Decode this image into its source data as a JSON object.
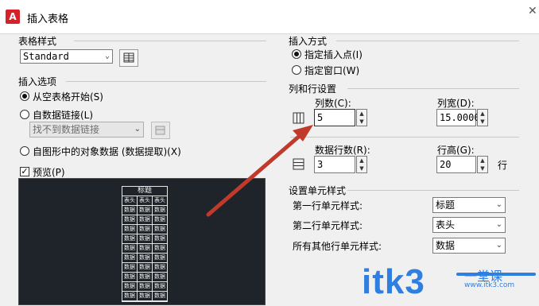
{
  "window": {
    "title": "插入表格",
    "app_icon": "A"
  },
  "table_style": {
    "label": "表格样式",
    "selected": "Standard"
  },
  "insert_options": {
    "label": "插入选项",
    "from_empty": "从空表格开始(S)",
    "from_data_link": "自数据链接(L)",
    "data_link_placeholder": "找不到数据链接",
    "from_object_data": "自图形中的对象数据 (数据提取)(X)"
  },
  "preview": {
    "label": "预览(P)",
    "checked": true,
    "table": {
      "title": "标题",
      "header": [
        "表头",
        "表头",
        "表头"
      ],
      "rows": [
        [
          "数据",
          "数据",
          "数据"
        ],
        [
          "数据",
          "数据",
          "数据"
        ],
        [
          "数据",
          "数据",
          "数据"
        ],
        [
          "数据",
          "数据",
          "数据"
        ],
        [
          "数据",
          "数据",
          "数据"
        ],
        [
          "数据",
          "数据",
          "数据"
        ],
        [
          "数据",
          "数据",
          "数据"
        ],
        [
          "数据",
          "数据",
          "数据"
        ],
        [
          "数据",
          "数据",
          "数据"
        ],
        [
          "数据",
          "数据",
          "数据"
        ]
      ]
    }
  },
  "insert_mode": {
    "label": "插入方式",
    "specify_point": "指定插入点(I)",
    "specify_window": "指定窗口(W)"
  },
  "column_row": {
    "label": "列和行设置",
    "columns_label": "列数(C):",
    "columns_value": "5",
    "col_width_label": "列宽(D):",
    "col_width_value": "15.0000",
    "data_rows_label": "数据行数(R):",
    "data_rows_value": "3",
    "row_height_label": "行高(G):",
    "row_height_value": "20",
    "row_unit": "行"
  },
  "cell_styles": {
    "label": "设置单元样式",
    "first_row_label": "第一行单元样式:",
    "first_row_value": "标题",
    "second_row_label": "第二行单元样式:",
    "second_row_value": "表头",
    "other_rows_label": "所有其他行单元样式:",
    "other_rows_value": "数据"
  },
  "watermark": {
    "text": "itk3",
    "cn": "一堂课",
    "sub": "www.itk3.com"
  },
  "colors": {
    "arrow": "#c0392b",
    "accent": "#2f7fe0",
    "preview_bg": "#1e242a"
  }
}
